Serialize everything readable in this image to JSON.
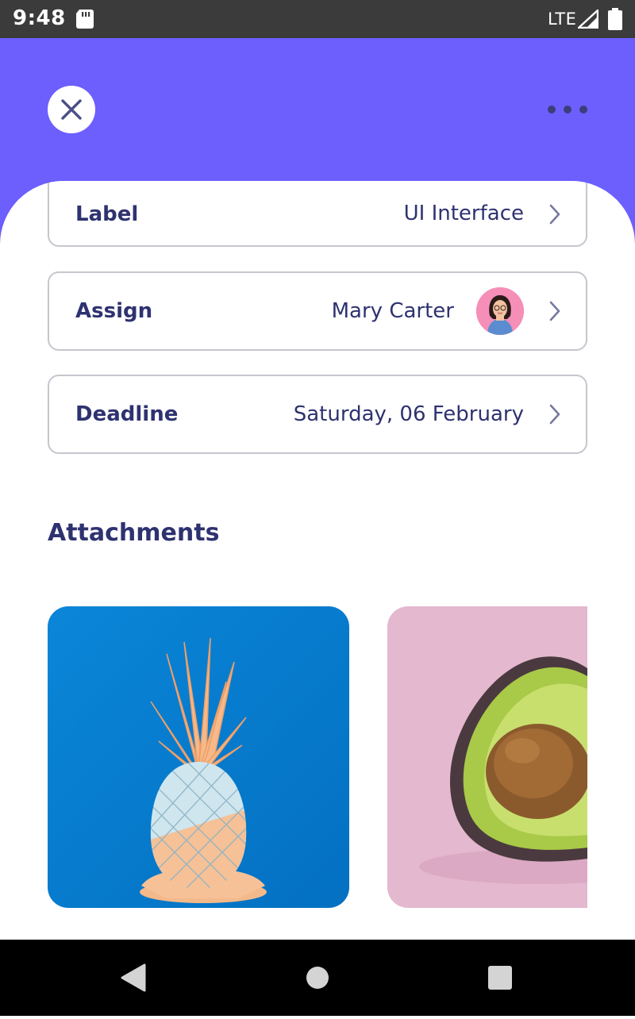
{
  "status_bar": {
    "time": "9:48",
    "network": "LTE",
    "icons": [
      "sd-card-icon",
      "signal-icon",
      "battery-icon"
    ]
  },
  "header": {
    "close_icon": "close-icon",
    "more_icon": "more-horizontal-icon",
    "background_color": "#6c5ffe"
  },
  "rows": [
    {
      "label": "Label",
      "value": "UI Interface"
    },
    {
      "label": "Assign",
      "value": "Mary Carter"
    },
    {
      "label": "Deadline",
      "value": "Saturday, 06 February"
    }
  ],
  "attachments": {
    "title": "Attachments",
    "items": [
      "pineapple-image",
      "avocado-image"
    ]
  },
  "nav_bar": {
    "icons": [
      "back-icon",
      "home-icon",
      "recents-icon"
    ]
  },
  "colors": {
    "accent": "#6c5ffe",
    "text": "#2e3270",
    "border": "#c6c6ce"
  }
}
